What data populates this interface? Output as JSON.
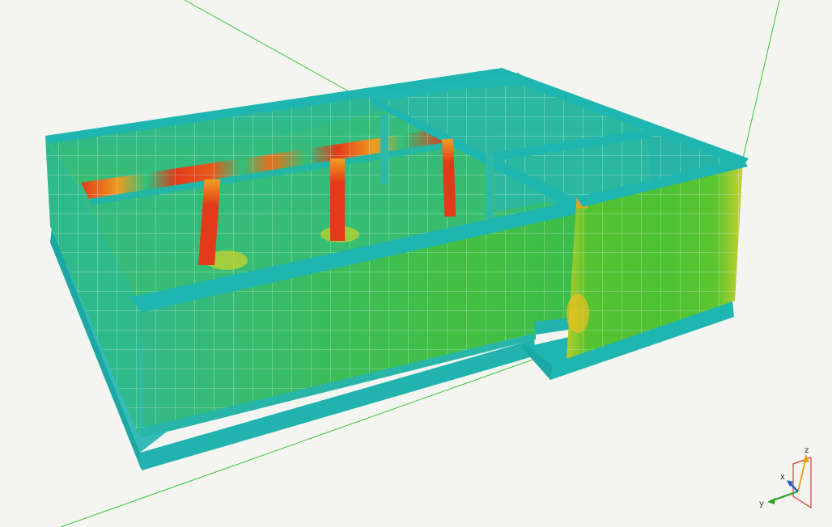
{
  "viewport": {
    "background": "#f4f5f0"
  },
  "colors": {
    "low": "#1fb5b0",
    "mid_low": "#2ec07a",
    "mid": "#4bc23a",
    "mid_high": "#c8d12e",
    "high": "#f0a020",
    "peak": "#e23a1a",
    "mesh_line": "#dfeeea",
    "guide_line": "#3cc63c"
  },
  "model": {
    "description_type": "fem-stress-contour",
    "element_style": "shell-mesh"
  },
  "axis_triad": {
    "x_label": "x",
    "y_label": "y",
    "z_label": "z",
    "x_color": "#1e5fd6",
    "y_color": "#2aa02a",
    "z_color": "#e8a21a",
    "plane_color": "#e03c3c"
  }
}
